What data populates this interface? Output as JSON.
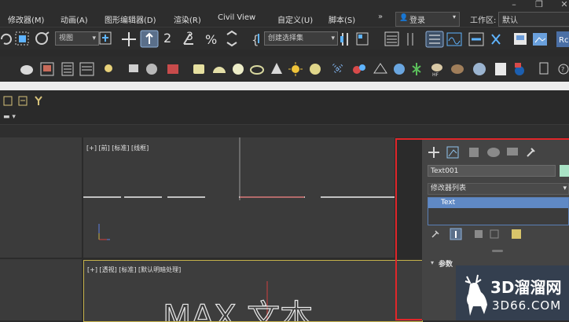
{
  "menu": {
    "items": [
      "修改器(M)",
      "动画(A)",
      "图形编辑器(D)",
      "渲染(R)",
      "Civil View",
      "自定义(U)",
      "脚本(S)"
    ],
    "overflow": "»",
    "login": "登录",
    "workspace_label": "工作区:",
    "workspace_value": "默认"
  },
  "toolbar": {
    "view_select": "视图",
    "selection_set": "创建选择集",
    "num_2": "2",
    "num_3": "3"
  },
  "viewports": {
    "front_label": "[+] [前] [标准] [线框]",
    "persp_label": "[+] [透视] [标准] [默认明暗处理]",
    "persp_text": "MAX 文本"
  },
  "command_panel": {
    "object_name": "Text001",
    "modifier_list": "修改器列表",
    "stack_item": "Text",
    "params_label": "参数",
    "object_color": "#a9e2c5"
  },
  "watermark": {
    "text": "3D溜溜网",
    "url": "3D66.COM"
  },
  "colors": {
    "highlight": "#e0262a",
    "selection": "#5f89c5",
    "active_viewport": "#c7b34b"
  }
}
